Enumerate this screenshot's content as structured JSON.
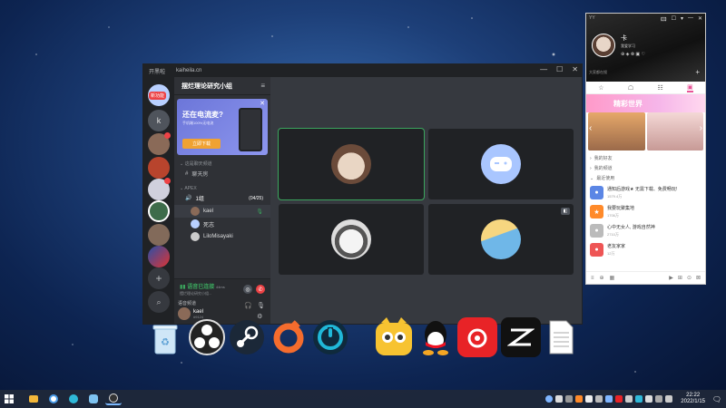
{
  "colors": {
    "discord_dark": "#36393f",
    "discord_sidebar": "#2f3136",
    "discord_guildbar": "#202225",
    "voice_green": "#3ba55d",
    "danger_red": "#ed4245",
    "qq_pink": "#e85598"
  },
  "discord": {
    "title": "开黑啦",
    "domain": "kaiheila.cn",
    "window_controls": [
      "—",
      "☐",
      "✕"
    ],
    "new_badge": "新功能",
    "guild_letter": "k",
    "guild_add": "+",
    "guild_search": "⌕",
    "server_name": "摆烂理论研究小组",
    "server_menu": "≡",
    "promo": {
      "title": "还在电流麦?",
      "subtitle": "手机端100%无电流",
      "button": "立即下载",
      "close": "✕"
    },
    "categories": [
      {
        "label": "这是聊天频道",
        "channels": [
          {
            "label": "聊天房"
          }
        ]
      },
      {
        "label": "APEX"
      }
    ],
    "voice_channel": {
      "label": "1组",
      "count": "(04/25)"
    },
    "voice_users": [
      {
        "name": "kael"
      },
      {
        "name": "死志"
      },
      {
        "name": "LiloMisayaki"
      }
    ],
    "voice_status": {
      "title": "语音已连接",
      "ping": "44ms",
      "subtitle": "摆烂理论研究小组..."
    },
    "user_bar": {
      "label": "语音频道",
      "username": "kael",
      "tag": "#9124"
    }
  },
  "qq": {
    "top_label": "YY",
    "window_controls": [
      "🖾",
      "☐",
      "▾",
      "—",
      "✕"
    ],
    "nickname": "卡",
    "signature": "我爱学习",
    "status_icons": "⊕ ◈ ⊗ ▣ ♡",
    "search_placeholder": "大家都在搜",
    "add_icon": "+",
    "tabs": [
      "☆",
      "☖",
      "☷",
      "▣"
    ],
    "banner_title": "精彩世界",
    "nav_left": "‹",
    "nav_right": "›",
    "groups": [
      "我的好友",
      "我的频道",
      "最近使用"
    ],
    "items": [
      {
        "title": "通知后游戏★ 无需下载、免费畅玩!",
        "meta": "1579.4万"
      },
      {
        "title": "我要玩聚集地",
        "meta": "1706万"
      },
      {
        "title": "心中无女人, 游戏自然神",
        "meta": "2710万"
      },
      {
        "title": "老友家家",
        "meta": "12万"
      }
    ],
    "bottom_icons": [
      "≡",
      "⊕",
      "▦"
    ],
    "bottom_right_icons": [
      "▶",
      "⊞",
      "⊙",
      "⊠"
    ]
  },
  "taskbar": {
    "time": "22:22",
    "date": "2022/1/15",
    "notification": "🗨"
  }
}
